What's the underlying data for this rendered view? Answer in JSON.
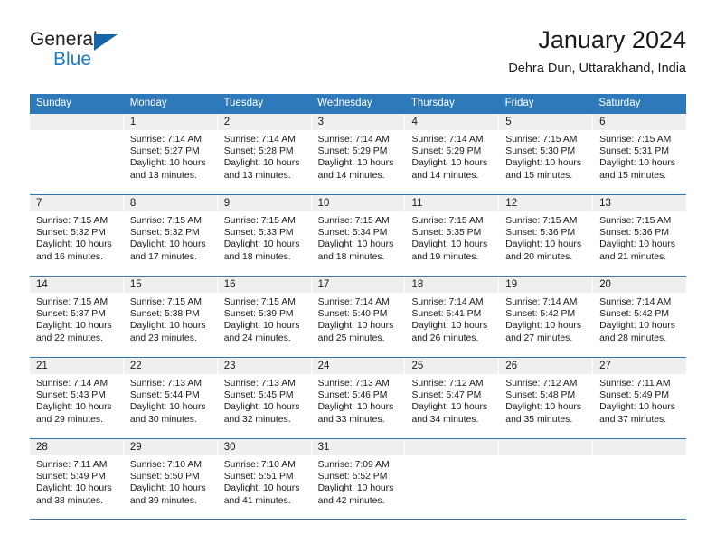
{
  "brand": {
    "name_line1": "General",
    "name_line2": "Blue",
    "logo_icon": "triangle-logo-icon",
    "accent_color": "#1a7dc4",
    "dark_color": "#1565a8"
  },
  "header": {
    "title": "January 2024",
    "subtitle": "Dehra Dun, Uttarakhand, India"
  },
  "theme": {
    "header_row_color": "#2e79b9",
    "day_number_bg": "#efefef",
    "text_color": "#1a1a1a"
  },
  "weekdays": [
    "Sunday",
    "Monday",
    "Tuesday",
    "Wednesday",
    "Thursday",
    "Friday",
    "Saturday"
  ],
  "weeks": [
    [
      {
        "day": "",
        "sunrise": "",
        "sunset": "",
        "daylight_line1": "",
        "daylight_line2": "",
        "empty": true
      },
      {
        "day": "1",
        "sunrise": "Sunrise: 7:14 AM",
        "sunset": "Sunset: 5:27 PM",
        "daylight_line1": "Daylight: 10 hours",
        "daylight_line2": "and 13 minutes."
      },
      {
        "day": "2",
        "sunrise": "Sunrise: 7:14 AM",
        "sunset": "Sunset: 5:28 PM",
        "daylight_line1": "Daylight: 10 hours",
        "daylight_line2": "and 13 minutes."
      },
      {
        "day": "3",
        "sunrise": "Sunrise: 7:14 AM",
        "sunset": "Sunset: 5:29 PM",
        "daylight_line1": "Daylight: 10 hours",
        "daylight_line2": "and 14 minutes."
      },
      {
        "day": "4",
        "sunrise": "Sunrise: 7:14 AM",
        "sunset": "Sunset: 5:29 PM",
        "daylight_line1": "Daylight: 10 hours",
        "daylight_line2": "and 14 minutes."
      },
      {
        "day": "5",
        "sunrise": "Sunrise: 7:15 AM",
        "sunset": "Sunset: 5:30 PM",
        "daylight_line1": "Daylight: 10 hours",
        "daylight_line2": "and 15 minutes."
      },
      {
        "day": "6",
        "sunrise": "Sunrise: 7:15 AM",
        "sunset": "Sunset: 5:31 PM",
        "daylight_line1": "Daylight: 10 hours",
        "daylight_line2": "and 15 minutes."
      }
    ],
    [
      {
        "day": "7",
        "sunrise": "Sunrise: 7:15 AM",
        "sunset": "Sunset: 5:32 PM",
        "daylight_line1": "Daylight: 10 hours",
        "daylight_line2": "and 16 minutes."
      },
      {
        "day": "8",
        "sunrise": "Sunrise: 7:15 AM",
        "sunset": "Sunset: 5:32 PM",
        "daylight_line1": "Daylight: 10 hours",
        "daylight_line2": "and 17 minutes."
      },
      {
        "day": "9",
        "sunrise": "Sunrise: 7:15 AM",
        "sunset": "Sunset: 5:33 PM",
        "daylight_line1": "Daylight: 10 hours",
        "daylight_line2": "and 18 minutes."
      },
      {
        "day": "10",
        "sunrise": "Sunrise: 7:15 AM",
        "sunset": "Sunset: 5:34 PM",
        "daylight_line1": "Daylight: 10 hours",
        "daylight_line2": "and 18 minutes."
      },
      {
        "day": "11",
        "sunrise": "Sunrise: 7:15 AM",
        "sunset": "Sunset: 5:35 PM",
        "daylight_line1": "Daylight: 10 hours",
        "daylight_line2": "and 19 minutes."
      },
      {
        "day": "12",
        "sunrise": "Sunrise: 7:15 AM",
        "sunset": "Sunset: 5:36 PM",
        "daylight_line1": "Daylight: 10 hours",
        "daylight_line2": "and 20 minutes."
      },
      {
        "day": "13",
        "sunrise": "Sunrise: 7:15 AM",
        "sunset": "Sunset: 5:36 PM",
        "daylight_line1": "Daylight: 10 hours",
        "daylight_line2": "and 21 minutes."
      }
    ],
    [
      {
        "day": "14",
        "sunrise": "Sunrise: 7:15 AM",
        "sunset": "Sunset: 5:37 PM",
        "daylight_line1": "Daylight: 10 hours",
        "daylight_line2": "and 22 minutes."
      },
      {
        "day": "15",
        "sunrise": "Sunrise: 7:15 AM",
        "sunset": "Sunset: 5:38 PM",
        "daylight_line1": "Daylight: 10 hours",
        "daylight_line2": "and 23 minutes."
      },
      {
        "day": "16",
        "sunrise": "Sunrise: 7:15 AM",
        "sunset": "Sunset: 5:39 PM",
        "daylight_line1": "Daylight: 10 hours",
        "daylight_line2": "and 24 minutes."
      },
      {
        "day": "17",
        "sunrise": "Sunrise: 7:14 AM",
        "sunset": "Sunset: 5:40 PM",
        "daylight_line1": "Daylight: 10 hours",
        "daylight_line2": "and 25 minutes."
      },
      {
        "day": "18",
        "sunrise": "Sunrise: 7:14 AM",
        "sunset": "Sunset: 5:41 PM",
        "daylight_line1": "Daylight: 10 hours",
        "daylight_line2": "and 26 minutes."
      },
      {
        "day": "19",
        "sunrise": "Sunrise: 7:14 AM",
        "sunset": "Sunset: 5:42 PM",
        "daylight_line1": "Daylight: 10 hours",
        "daylight_line2": "and 27 minutes."
      },
      {
        "day": "20",
        "sunrise": "Sunrise: 7:14 AM",
        "sunset": "Sunset: 5:42 PM",
        "daylight_line1": "Daylight: 10 hours",
        "daylight_line2": "and 28 minutes."
      }
    ],
    [
      {
        "day": "21",
        "sunrise": "Sunrise: 7:14 AM",
        "sunset": "Sunset: 5:43 PM",
        "daylight_line1": "Daylight: 10 hours",
        "daylight_line2": "and 29 minutes."
      },
      {
        "day": "22",
        "sunrise": "Sunrise: 7:13 AM",
        "sunset": "Sunset: 5:44 PM",
        "daylight_line1": "Daylight: 10 hours",
        "daylight_line2": "and 30 minutes."
      },
      {
        "day": "23",
        "sunrise": "Sunrise: 7:13 AM",
        "sunset": "Sunset: 5:45 PM",
        "daylight_line1": "Daylight: 10 hours",
        "daylight_line2": "and 32 minutes."
      },
      {
        "day": "24",
        "sunrise": "Sunrise: 7:13 AM",
        "sunset": "Sunset: 5:46 PM",
        "daylight_line1": "Daylight: 10 hours",
        "daylight_line2": "and 33 minutes."
      },
      {
        "day": "25",
        "sunrise": "Sunrise: 7:12 AM",
        "sunset": "Sunset: 5:47 PM",
        "daylight_line1": "Daylight: 10 hours",
        "daylight_line2": "and 34 minutes."
      },
      {
        "day": "26",
        "sunrise": "Sunrise: 7:12 AM",
        "sunset": "Sunset: 5:48 PM",
        "daylight_line1": "Daylight: 10 hours",
        "daylight_line2": "and 35 minutes."
      },
      {
        "day": "27",
        "sunrise": "Sunrise: 7:11 AM",
        "sunset": "Sunset: 5:49 PM",
        "daylight_line1": "Daylight: 10 hours",
        "daylight_line2": "and 37 minutes."
      }
    ],
    [
      {
        "day": "28",
        "sunrise": "Sunrise: 7:11 AM",
        "sunset": "Sunset: 5:49 PM",
        "daylight_line1": "Daylight: 10 hours",
        "daylight_line2": "and 38 minutes."
      },
      {
        "day": "29",
        "sunrise": "Sunrise: 7:10 AM",
        "sunset": "Sunset: 5:50 PM",
        "daylight_line1": "Daylight: 10 hours",
        "daylight_line2": "and 39 minutes."
      },
      {
        "day": "30",
        "sunrise": "Sunrise: 7:10 AM",
        "sunset": "Sunset: 5:51 PM",
        "daylight_line1": "Daylight: 10 hours",
        "daylight_line2": "and 41 minutes."
      },
      {
        "day": "31",
        "sunrise": "Sunrise: 7:09 AM",
        "sunset": "Sunset: 5:52 PM",
        "daylight_line1": "Daylight: 10 hours",
        "daylight_line2": "and 42 minutes."
      },
      {
        "day": "",
        "sunrise": "",
        "sunset": "",
        "daylight_line1": "",
        "daylight_line2": "",
        "empty": true
      },
      {
        "day": "",
        "sunrise": "",
        "sunset": "",
        "daylight_line1": "",
        "daylight_line2": "",
        "empty": true
      },
      {
        "day": "",
        "sunrise": "",
        "sunset": "",
        "daylight_line1": "",
        "daylight_line2": "",
        "empty": true
      }
    ]
  ]
}
